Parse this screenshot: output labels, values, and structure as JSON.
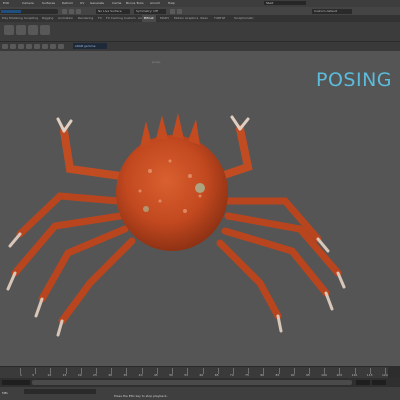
{
  "menubar": {
    "items": [
      "Edit",
      "Camera",
      "Surfaces",
      "Deform",
      "UV",
      "Generate",
      "Cache",
      "Bonus Tools",
      "Arnold",
      "Help"
    ],
    "right_field": "Start"
  },
  "status_line": {
    "no_live_surface": "No Live Surface",
    "symmetry": "Symmetry: Off",
    "custom": "Custom default"
  },
  "shelf_tabs": {
    "items": [
      "Poly Modeling",
      "Sculpting",
      "Rigging",
      "Animation",
      "Rendering",
      "FX",
      "FX Caching",
      "Custom",
      "Arnold",
      "Bifrost",
      "MASH",
      "Motion Graphics",
      "XGen",
      "TURTLE",
      "Sculptomatic"
    ],
    "active_index": 9
  },
  "panel_toolbar": {
    "colorspace": "sRGB gamma"
  },
  "viewport": {
    "camera_label": "persp",
    "overlay_title": "POSING R"
  },
  "timeline": {
    "start_frame": "1",
    "end_frame": "120",
    "labels": [
      "5",
      "10",
      "15",
      "20",
      "25",
      "30",
      "35",
      "40",
      "45",
      "50",
      "55",
      "60",
      "65",
      "70",
      "75",
      "80",
      "85",
      "90",
      "95",
      "100",
      "105",
      "110",
      "115",
      "120"
    ]
  },
  "command_line": {
    "label": "MEL",
    "help_text": "Press the ESC key to stop playback."
  },
  "colors": {
    "accent_title": "#5bbcdc",
    "crab_shell": "#c2481f",
    "viewport_bg": "#555555"
  }
}
